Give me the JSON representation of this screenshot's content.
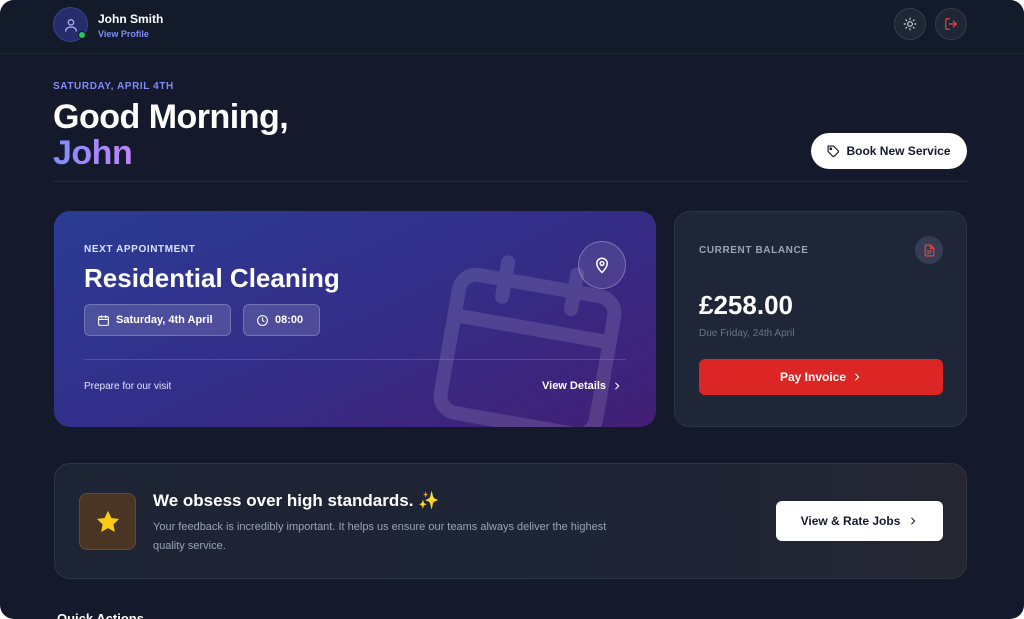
{
  "header": {
    "user_name": "John Smith",
    "profile_link": "View Profile",
    "icons": [
      "user-icon",
      "sun-icon",
      "logout-icon"
    ],
    "online_color": "#22c55e"
  },
  "greeting": {
    "date": "SATURDAY, APRIL 4TH",
    "line1": "Good Morning,",
    "name": "John",
    "book_button": "Book New Service"
  },
  "appointment": {
    "label": "NEXT APPOINTMENT",
    "title": "Residential Cleaning",
    "date_chip": "Saturday, 4th April",
    "time_chip": "08:00",
    "footer_text": "Prepare for our visit",
    "details_link": "View Details"
  },
  "balance": {
    "label": "CURRENT BALANCE",
    "amount": "£258.00",
    "due": "Due Friday, 24th April",
    "pay_button": "Pay Invoice",
    "accent": "#dc2626"
  },
  "standards": {
    "title": "We obsess over high standards.",
    "emoji": "✨",
    "text": "Your feedback is incredibly important. It helps us ensure our teams always deliver the highest quality service.",
    "button": "View & Rate Jobs"
  },
  "quick_actions": {
    "title": "Quick Actions"
  },
  "colors": {
    "background": "#141a2b",
    "brand": "#818cf8",
    "card": "#1e2637"
  }
}
